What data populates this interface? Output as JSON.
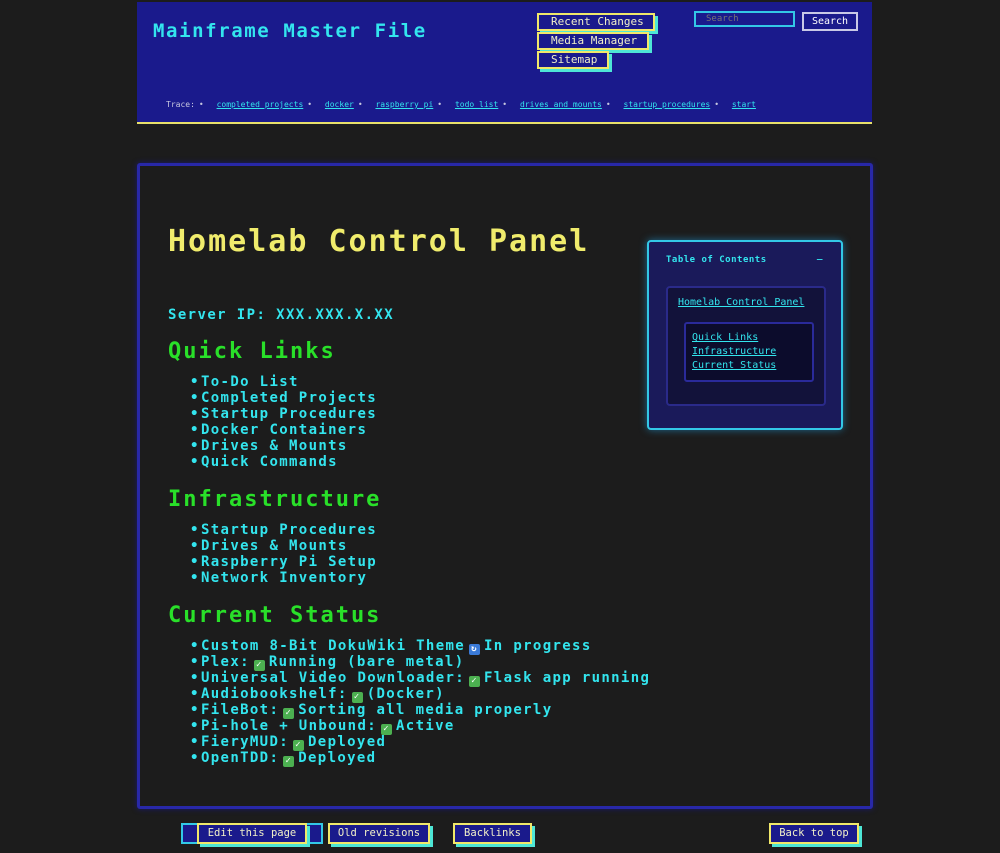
{
  "header": {
    "site_title": "Mainframe Master File",
    "menu": {
      "recent_changes": "Recent Changes",
      "media_manager": "Media Manager",
      "sitemap": "Sitemap"
    },
    "search": {
      "placeholder": "Search",
      "button": "Search"
    },
    "breadcrumb": {
      "label": "Trace:",
      "items": [
        "completed projects",
        "docker",
        "raspberry pi",
        "todo list",
        "drives and mounts",
        "startup procedures",
        "start"
      ]
    }
  },
  "page": {
    "title": "Homelab Control Panel",
    "server_ip_label": "Server IP:",
    "server_ip_value": "XXX.XXX.X.XX",
    "sections": {
      "quick_links": {
        "heading": "Quick Links",
        "items": [
          "To-Do List",
          "Completed Projects",
          "Startup Procedures",
          "Docker Containers",
          "Drives & Mounts",
          "Quick Commands"
        ]
      },
      "infrastructure": {
        "heading": "Infrastructure",
        "items": [
          "Startup Procedures",
          "Drives & Mounts",
          "Raspberry Pi Setup",
          "Network Inventory"
        ]
      },
      "current_status": {
        "heading": "Current Status",
        "items": [
          {
            "label": "Custom 8-Bit DokuWiki Theme",
            "icon": "cycle-icon",
            "status": "In progress"
          },
          {
            "label": "Plex:",
            "icon": "check-icon",
            "status": "Running (bare metal)"
          },
          {
            "label": "Universal Video Downloader:",
            "icon": "check-icon",
            "status": "Flask app running"
          },
          {
            "label": "Audiobookshelf:",
            "icon": "check-icon",
            "status": "(Docker)"
          },
          {
            "label": "FileBot:",
            "icon": "check-icon",
            "status": "Sorting all media properly"
          },
          {
            "label": "Pi-hole + Unbound:",
            "icon": "check-icon",
            "status": "Active"
          },
          {
            "label": "FieryMUD:",
            "icon": "check-icon",
            "status": "Deployed"
          },
          {
            "label": "OpenTDD:",
            "icon": "check-icon",
            "status": "Deployed"
          }
        ]
      }
    }
  },
  "toc": {
    "title": "Table of Contents",
    "toggle": "−",
    "top_link": "Homelab Control Panel",
    "sub_links": [
      "Quick Links",
      "Infrastructure",
      "Current Status"
    ]
  },
  "footer": {
    "edit": "Edit this page",
    "old_revisions": "Old revisions",
    "backlinks": "Backlinks",
    "back_to_top": "Back to top"
  },
  "colors": {
    "header_bg": "#1a1a8c",
    "title_yellow": "#f0ec6c",
    "cyan": "#33e5ee",
    "green_heading": "#29e029",
    "page_bg": "#1c1c1c"
  }
}
